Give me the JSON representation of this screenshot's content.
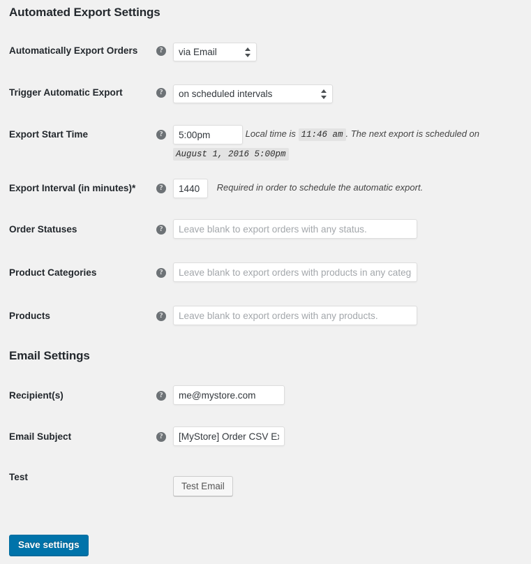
{
  "sections": {
    "automated": {
      "heading": "Automated Export Settings"
    },
    "email": {
      "heading": "Email Settings"
    }
  },
  "help_icon_glyph": "?",
  "icons": {
    "help": "help-icon",
    "select_arrows": "select-updown-arrows-icon"
  },
  "colors": {
    "page_background": "#f1f1f1",
    "primary_button": "#0073aa",
    "heading_text": "#23282d",
    "help_icon": "#6d7276",
    "code_highlight_background": "#e3e3e3"
  },
  "fields": {
    "auto_export_orders": {
      "label": "Automatically Export Orders",
      "value": "via Email",
      "options": [
        "via Email"
      ]
    },
    "trigger_export": {
      "label": "Trigger Automatic Export",
      "value": "on scheduled intervals",
      "options": [
        "on scheduled intervals"
      ]
    },
    "start_time": {
      "label": "Export Start Time",
      "value": "5:00pm",
      "desc_part1": "Local time is",
      "desc_code1": "11:46 am",
      "desc_part2": ". The next export is scheduled on",
      "desc_code2": "August 1, 2016 5:00pm"
    },
    "interval": {
      "label": "Export Interval (in minutes)*",
      "value": "1440",
      "description": "Required in order to schedule the automatic export."
    },
    "order_statuses": {
      "label": "Order Statuses",
      "value": "",
      "placeholder": "Leave blank to export orders with any status."
    },
    "product_categories": {
      "label": "Product Categories",
      "value": "",
      "placeholder": "Leave blank to export orders with products in any category."
    },
    "products": {
      "label": "Products",
      "value": "",
      "placeholder": "Leave blank to export orders with any products."
    },
    "recipients": {
      "label": "Recipient(s)",
      "value": "me@mystore.com",
      "placeholder": ""
    },
    "email_subject": {
      "label": "Email Subject",
      "value": "[MyStore] Order CSV Export",
      "placeholder": ""
    },
    "test": {
      "label": "Test",
      "button_label": "Test Email"
    }
  },
  "actions": {
    "save_label": "Save settings"
  }
}
